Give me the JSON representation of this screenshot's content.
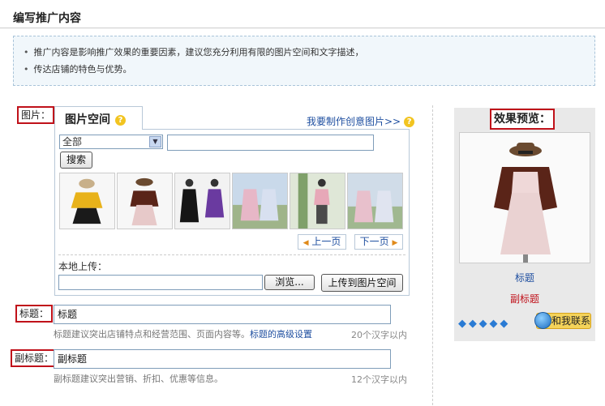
{
  "page": {
    "title": "编写推广内容"
  },
  "tips": [
    "推广内容是影响推广效果的重要因素，建议您充分利用有限的图片空间和文字描述，",
    "传达店铺的特色与优势。"
  ],
  "labels": {
    "image": "图片：",
    "title": "标题：",
    "subtitle": "副标题：",
    "preview": "效果预览："
  },
  "picker": {
    "tab_label": "图片空间",
    "help_icon": "?",
    "create_link": "我要制作创意图片>>",
    "category_selected": "全部",
    "search_value": "",
    "search_button": "搜索",
    "thumbnails": [
      {
        "name": "yellow-jacket-black-skirt",
        "colors": [
          "#e8b21a",
          "#1a1a1a",
          "#8a6a3a"
        ]
      },
      {
        "name": "brown-jacket-pink-dress",
        "colors": [
          "#5a2418",
          "#e7c9c9",
          "#6a4a30"
        ]
      },
      {
        "name": "black-dress-and-purple-dress",
        "colors": [
          "#151515",
          "#6a3aa0",
          "#333333"
        ]
      },
      {
        "name": "two-girls-floral-dresses",
        "colors": [
          "#c9d9ea",
          "#e7b7c7",
          "#9fb48a"
        ]
      },
      {
        "name": "girl-pink-top-outdoor",
        "colors": [
          "#e7a8b8",
          "#4a4a4a",
          "#7fa06a"
        ]
      },
      {
        "name": "two-girls-floral-dresses-2",
        "colors": [
          "#d0dce8",
          "#e8c0cc",
          "#a0b890"
        ]
      }
    ],
    "prev_label": "上一页",
    "next_label": "下一页",
    "prev_arrow": "◀",
    "next_arrow": "▶",
    "upload_label": "本地上传：",
    "file_value": "",
    "browse_label": "浏览...",
    "upload_button": "上传到图片空间"
  },
  "title_field": {
    "value": "标题",
    "hint": "标题建议突出店铺特点和经营范围、页面内容等。",
    "hint_link": "标题的高级设置",
    "counter": "20个汉字以内"
  },
  "subtitle_field": {
    "value": "副标题",
    "hint": "副标题建议突出营销、折扣、优惠等信息。",
    "counter": "12个汉字以内"
  },
  "preview": {
    "title": "标题",
    "subtitle": "副标题",
    "rating_diamonds": 5,
    "diamond_glyph": "◆",
    "contact_label": "和我联系"
  },
  "colors": {
    "accent_red": "#c0111a",
    "link_blue": "#1f4fa0",
    "info_bg": "#f1f7fb"
  }
}
